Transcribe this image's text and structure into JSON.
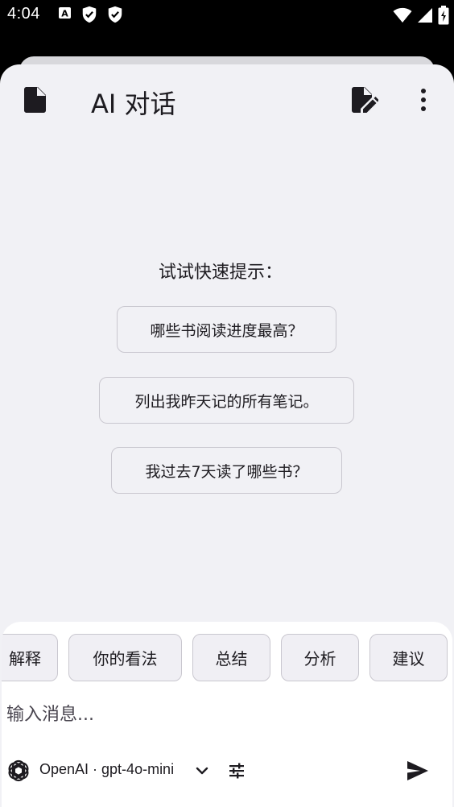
{
  "status_bar": {
    "time": "4:04",
    "notification_icons": [
      "a-badge-icon",
      "shield-check-icon",
      "shield-check-icon"
    ],
    "system_icons": [
      "wifi-icon",
      "signal-icon",
      "battery-charging-icon"
    ]
  },
  "header": {
    "title": "AI 对话"
  },
  "quick_prompts": {
    "label": "试试快速提示：",
    "items": [
      "哪些书阅读进度最高？",
      "列出我昨天记的所有笔记。",
      "我过去7天读了哪些书？"
    ]
  },
  "chips": [
    "解释",
    "你的看法",
    "总结",
    "分析",
    "建议"
  ],
  "composer": {
    "placeholder": "输入消息...",
    "model_label": "OpenAI · gpt-4o-mini"
  },
  "colors": {
    "sheet_background": "#f1f1f5",
    "composer_background": "#ffffff",
    "text": "#1d1b20",
    "outline": "#c9c7cf"
  }
}
